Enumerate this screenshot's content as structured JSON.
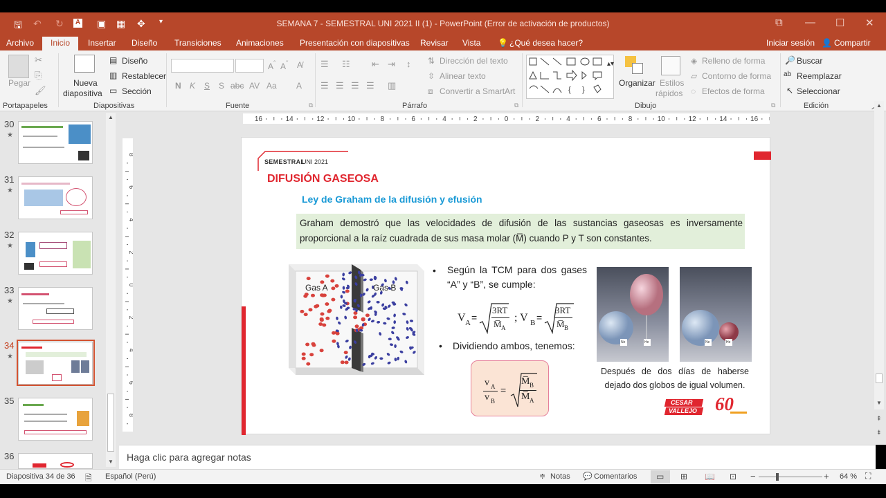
{
  "window": {
    "title": "SEMANA 7 - SEMESTRAL UNI 2021 II (1) - PowerPoint (Error de activación de productos)"
  },
  "tabs": [
    {
      "label": "Archivo"
    },
    {
      "label": "Inicio"
    },
    {
      "label": "Insertar"
    },
    {
      "label": "Diseño"
    },
    {
      "label": "Transiciones"
    },
    {
      "label": "Animaciones"
    },
    {
      "label": "Presentación con diapositivas"
    },
    {
      "label": "Revisar"
    },
    {
      "label": "Vista"
    },
    {
      "label": "¿Qué desea hacer?"
    }
  ],
  "account": {
    "signin": "Iniciar sesión",
    "share": "Compartir"
  },
  "ribbon": {
    "clipboard": {
      "paste": "Pegar",
      "group": "Portapapeles"
    },
    "slides": {
      "new_slide_1": "Nueva",
      "new_slide_2": "diapositiva",
      "layout": "Diseño",
      "reset": "Restablecer",
      "section": "Sección",
      "group": "Diapositivas"
    },
    "font": {
      "bold": "N",
      "italic": "K",
      "underline": "S",
      "strike": "S",
      "spacing": "abc",
      "case": "Aa",
      "color": "A",
      "group": "Fuente"
    },
    "paragraph": {
      "text_dir": "Dirección del texto",
      "align_text": "Alinear texto",
      "smartart": "Convertir a SmartArt",
      "group": "Párrafo"
    },
    "drawing": {
      "arrange": "Organizar",
      "quick_styles_1": "Estilos",
      "quick_styles_2": "rápidos",
      "fill": "Relleno de forma",
      "outline": "Contorno de forma",
      "effects": "Efectos de forma",
      "group": "Dibujo"
    },
    "editing": {
      "find": "Buscar",
      "replace": "Reemplazar",
      "select": "Seleccionar",
      "group": "Edición"
    }
  },
  "ruler": {
    "labels": [
      "16",
      "14",
      "12",
      "10",
      "8",
      "6",
      "4",
      "2",
      "0",
      "2",
      "4",
      "6",
      "8",
      "10",
      "12",
      "14",
      "16"
    ]
  },
  "vruler": {
    "labels": [
      "8",
      "6",
      "4",
      "2",
      "0",
      "2",
      "4",
      "6",
      "8"
    ]
  },
  "thumbnails": [
    {
      "num": "30"
    },
    {
      "num": "31"
    },
    {
      "num": "32"
    },
    {
      "num": "33"
    },
    {
      "num": "34"
    },
    {
      "num": "35"
    },
    {
      "num": "36"
    }
  ],
  "slide": {
    "header": "SEMESTRAL",
    "header_year": "UNI 2021",
    "title": "DIFUSIÓN GASEOSA",
    "subtitle": "Ley de Graham de la difusión y efusión",
    "box_line1": "Graham demostró que las velocidades de difusión de las sustancias gaseosas es inversamente",
    "box_line2": "proporcional a la raíz cuadrada de sus masa molar (M̅) cuando P y T son constantes.",
    "gas_a": "Gas A",
    "gas_b": "Gas B",
    "bullet1_line1": "Según la TCM para dos gases",
    "bullet1_line2": "“A” y “B”, se cumple:",
    "bullet2": "Dividiendo ambos, tenemos:",
    "f1_lhs": "V",
    "f1_sub_a": "A",
    "f1_num": "3RT",
    "f1_den": "M̅",
    "f1_sep": "; V",
    "f1_sub_b": "B",
    "f2_num": "v",
    "f2_den": "v",
    "caption_line1": "Después de dos días de haberse",
    "caption_line2": "dejado dos globos de igual volumen.",
    "logo1_line1": "CESAR",
    "logo1_line2": "VALLEJO",
    "logo2": "60",
    "label_ne": "Ne",
    "label_he": "He"
  },
  "notes": {
    "placeholder": "Haga clic para agregar notas"
  },
  "status": {
    "slide": "Diapositiva 34 de 36",
    "language": "Español (Perú)",
    "notes": "Notas",
    "comments": "Comentarios",
    "zoom": "64 %"
  },
  "colors": {
    "accent": "#b7472a",
    "title_red": "#e0262f",
    "subtitle_blue": "#1a9ad6",
    "box_green": "#e2efda"
  }
}
